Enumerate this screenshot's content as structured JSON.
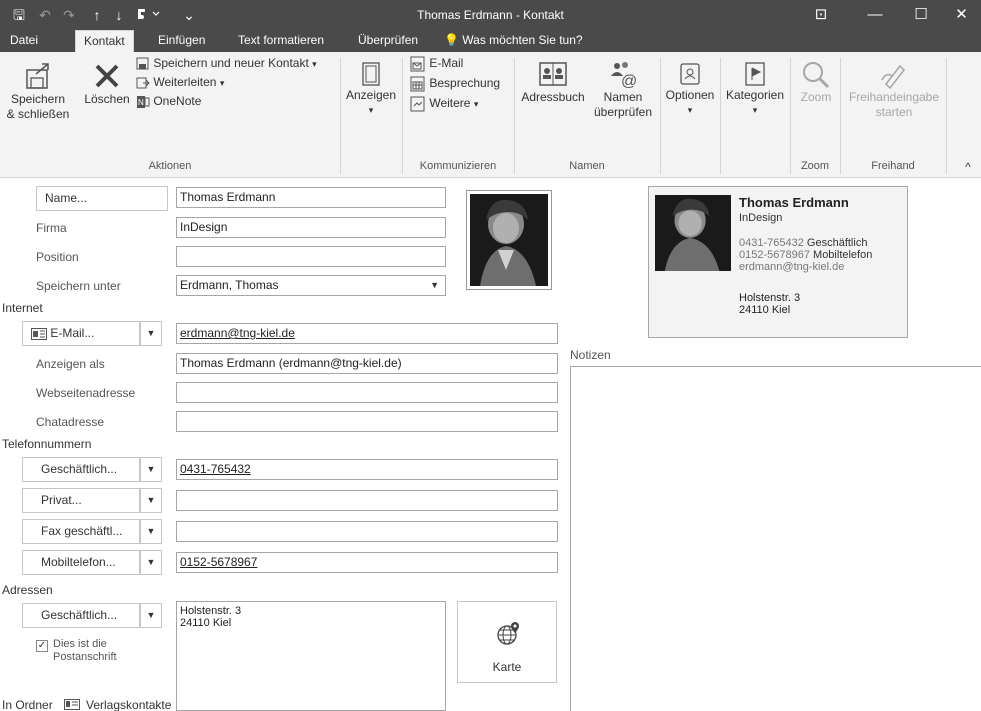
{
  "window": {
    "title": "Thomas Erdmann - Kontakt",
    "minimize": "—",
    "maximize": "☐",
    "close": "✕",
    "ribbon_display": "⊡"
  },
  "quick_access": {
    "save": "🖫",
    "undo": "↶",
    "redo": "↷",
    "up": "↑",
    "down": "↓",
    "more": "⌄"
  },
  "tabs": [
    {
      "label": "Datei"
    },
    {
      "label": "Kontakt"
    },
    {
      "label": "Einfügen"
    },
    {
      "label": "Text formatieren"
    },
    {
      "label": "Überprüfen"
    },
    {
      "label": "Was möchten Sie tun?"
    }
  ],
  "ribbon": {
    "aktionen": {
      "label": "Aktionen",
      "save_close": [
        "Speichern",
        "& schließen"
      ],
      "delete": "Löschen",
      "save_new": "Speichern und neuer Kontakt",
      "forward": "Weiterleiten",
      "onenote": "OneNote"
    },
    "anzeigen": {
      "label": "Anzeigen"
    },
    "kommunizieren": {
      "label": "Kommunizieren",
      "email": "E-Mail",
      "meeting": "Besprechung",
      "more": "Weitere"
    },
    "namen": {
      "label": "Namen",
      "addressbook": "Adressbuch",
      "check": [
        "Namen",
        "überprüfen"
      ]
    },
    "options": "Optionen",
    "categories": "Kategorien",
    "zoom": {
      "label": "Zoom",
      "button": "Zoom"
    },
    "freihand": {
      "label": "Freihand",
      "button": [
        "Freihandeingabe",
        "starten"
      ]
    },
    "collapse": "^"
  },
  "form": {
    "name_button": "Name...",
    "name_value": "Thomas Erdmann",
    "company_label": "Firma",
    "company_value": "InDesign",
    "position_label": "Position",
    "position_value": "",
    "file_as_label": "Speichern unter",
    "file_as_value": "Erdmann, Thomas",
    "internet_section": "Internet",
    "email_button": "E-Mail...",
    "email_value": "erdmann@tng-kiel.de",
    "display_as_label": "Anzeigen als",
    "display_as_value": "Thomas Erdmann (erdmann@tng-kiel.de)",
    "web_label": "Webseitenadresse",
    "chat_label": "Chatadresse",
    "phone_section": "Telefonnummern",
    "phones": [
      {
        "type": "Geschäftlich...",
        "value": "0431-765432"
      },
      {
        "type": "Privat...",
        "value": ""
      },
      {
        "type": "Fax geschäftl...",
        "value": ""
      },
      {
        "type": "Mobiltelefon...",
        "value": "0152-5678967"
      }
    ],
    "address_section": "Adressen",
    "address_type": "Geschäftlich...",
    "address_lines": [
      "Holstenstr. 3",
      "24110 Kiel"
    ],
    "postal_check": "✓",
    "postal_label": [
      "Dies ist die",
      "Postanschrift"
    ],
    "map_button": "Karte",
    "folder_label": "In Ordner",
    "folder_value": "Verlagskontakte"
  },
  "card": {
    "name": "Thomas Erdmann",
    "company": "InDesign",
    "phone_business": "0431-765432",
    "phone_business_label": "Geschäftlich",
    "phone_mobile": "0152-5678967",
    "phone_mobile_label": "Mobiltelefon",
    "email": "erdmann@tng-kiel.de",
    "street": "Holstenstr. 3",
    "city": "24110 Kiel"
  },
  "notes_label": "Notizen"
}
